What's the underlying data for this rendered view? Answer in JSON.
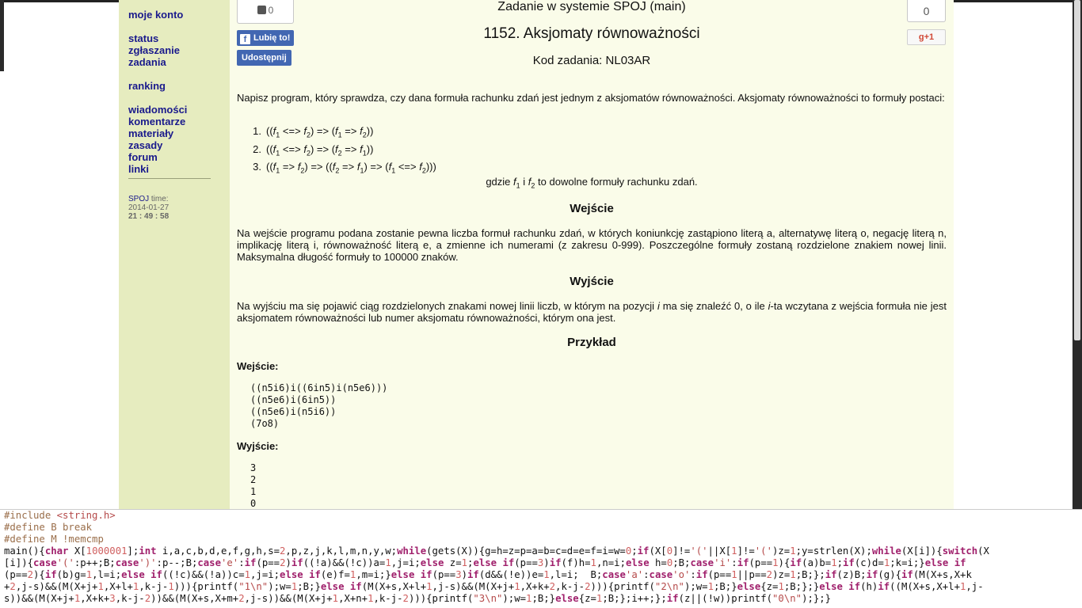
{
  "sidebar": {
    "links": [
      {
        "label": "moje konto"
      },
      {
        "label": "status"
      },
      {
        "label": "zgłaszanie"
      },
      {
        "label": "zadania"
      },
      {
        "label": "ranking"
      },
      {
        "label": "wiadomości"
      },
      {
        "label": "komentarze"
      },
      {
        "label": "materiały"
      },
      {
        "label": "zasady"
      },
      {
        "label": "forum"
      },
      {
        "label": "linki"
      }
    ],
    "time_brand": "SPOJ",
    "time_label": "time:",
    "date": "2014-01-27",
    "clock": "21 : 49 : 58"
  },
  "social": {
    "like_count": "0",
    "fb_like": "Lubię to!",
    "fb_share": "Udostępnij",
    "gplus_count": "0",
    "gplus_label": "g+1"
  },
  "problem": {
    "system": "Zadanie w systemie SPOJ (main)",
    "title": "1152. Aksjomaty równoważności",
    "code": "Kod zadania: NL03AR",
    "intro": "Napisz program, który sprawdza, czy dana formuła rachunku zdań jest jednym z aksjomatów równoważności. Aksjomaty równoważności to formuły postaci:",
    "where": "to dowolne formuły rachunku zdań.",
    "input_heading": "Wejście",
    "input_text": "Na wejście programu podana zostanie pewna liczba formuł rachunku zdań, w których koniunkcję zastąpiono literą a, alternatywę literą o, negację literą n, implikację literą i, równoważność literą e, a zmienne ich numerami (z zakresu 0-999). Poszczególne formuły zostaną rozdzielone znakiem nowej linii. Maksymalna długość formuły to 100000 znaków.",
    "output_heading": "Wyjście",
    "output_text_1": "Na wyjściu ma się pojawić ciąg rozdzielonych znakami nowej linii liczb, w którym na pozycji",
    "output_text_i": "i",
    "output_text_2": "ma się znaleźć 0, o ile",
    "output_text_3": "-ta wczytana z wejścia formuła nie jest aksjomatem równoważności lub numer aksjomatu równoważności, którym ona jest.",
    "example_heading": "Przykład",
    "ex_in_label": "Wejście:",
    "ex_in": "((n5i6)i((6in5)i(n5e6)))\n((n5e6)i(6in5))\n((n5e6)i(n5i6))\n(7o8)",
    "ex_out_label": "Wyjście:",
    "ex_out": "3\n2\n1\n0"
  }
}
